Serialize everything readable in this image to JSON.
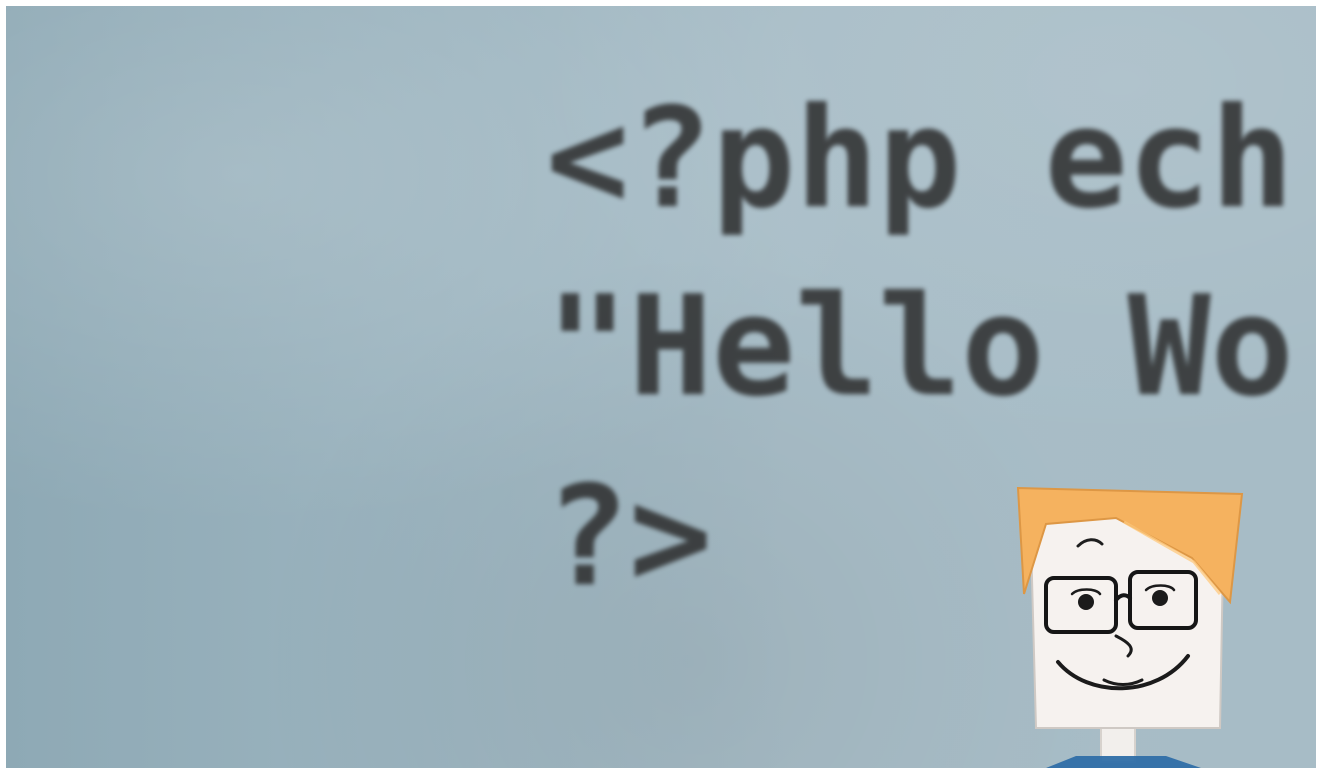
{
  "code_lines": [
    "<?php ech",
    "\"Hello Wo",
    "?>"
  ]
}
